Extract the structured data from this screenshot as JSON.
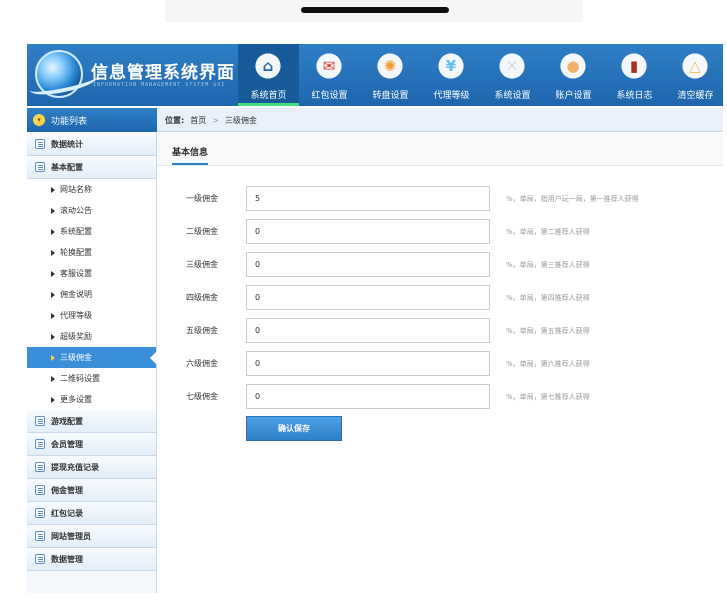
{
  "app": {
    "title": "信息管理系统界面",
    "subtitle": "INFORMATION MANAGEMENT SYSTEM GUI"
  },
  "nav": [
    {
      "label": "系统首页",
      "icon": "home-icon",
      "color": "#1e66ad",
      "active": true
    },
    {
      "label": "红包设置",
      "icon": "red-envelope-icon",
      "color": "#e8362d"
    },
    {
      "label": "转盘设置",
      "icon": "color-wheel-icon",
      "color": "#f59b2e"
    },
    {
      "label": "代理等级",
      "icon": "money-cloud-icon",
      "color": "#5ec1f0"
    },
    {
      "label": "系统设置",
      "icon": "tools-icon",
      "color": "#d8dde3"
    },
    {
      "label": "账户设置",
      "icon": "user-icon",
      "color": "#f2b06c"
    },
    {
      "label": "系统日志",
      "icon": "book-icon",
      "color": "#a5331f"
    },
    {
      "label": "清空缓存",
      "icon": "broom-icon",
      "color": "#f2c14e"
    }
  ],
  "sidebar": {
    "header": "功能列表",
    "sections": [
      {
        "label": "数据统计"
      },
      {
        "label": "基本配置",
        "items": [
          {
            "label": "网站名称"
          },
          {
            "label": "滚动公告"
          },
          {
            "label": "系统配置"
          },
          {
            "label": "轮换配置"
          },
          {
            "label": "客服设置"
          },
          {
            "label": "佣金说明"
          },
          {
            "label": "代理等级"
          },
          {
            "label": "超级奖励"
          },
          {
            "label": "三级佣金",
            "active": true
          },
          {
            "label": "二维码设置"
          },
          {
            "label": "更多设置"
          }
        ]
      },
      {
        "label": "游戏配置"
      },
      {
        "label": "会员管理"
      },
      {
        "label": "提现充值记录"
      },
      {
        "label": "佣金管理"
      },
      {
        "label": "红包记录"
      },
      {
        "label": "网站管理员"
      },
      {
        "label": "数据管理"
      }
    ]
  },
  "breadcrumb": {
    "prefix": "位置:",
    "home": "首页",
    "separator": ">",
    "current": "三级佣金"
  },
  "form": {
    "tab": "基本信息",
    "fields": [
      {
        "label": "一级佣金",
        "value": "5",
        "hint": "%，单局，指用户玩一局，第一推荐人获得"
      },
      {
        "label": "二级佣金",
        "value": "0",
        "hint": "%，单局，第二推荐人获得"
      },
      {
        "label": "三级佣金",
        "value": "0",
        "hint": "%，单局，第三推荐人获得"
      },
      {
        "label": "四级佣金",
        "value": "0",
        "hint": "%，单局，第四推荐人获得"
      },
      {
        "label": "五级佣金",
        "value": "0",
        "hint": "%，单局，第五推荐人获得"
      },
      {
        "label": "六级佣金",
        "value": "0",
        "hint": "%，单局，第六推荐人获得"
      },
      {
        "label": "七级佣金",
        "value": "0",
        "hint": "%，单局，第七推荐人获得"
      }
    ],
    "save_label": "确认保存"
  }
}
